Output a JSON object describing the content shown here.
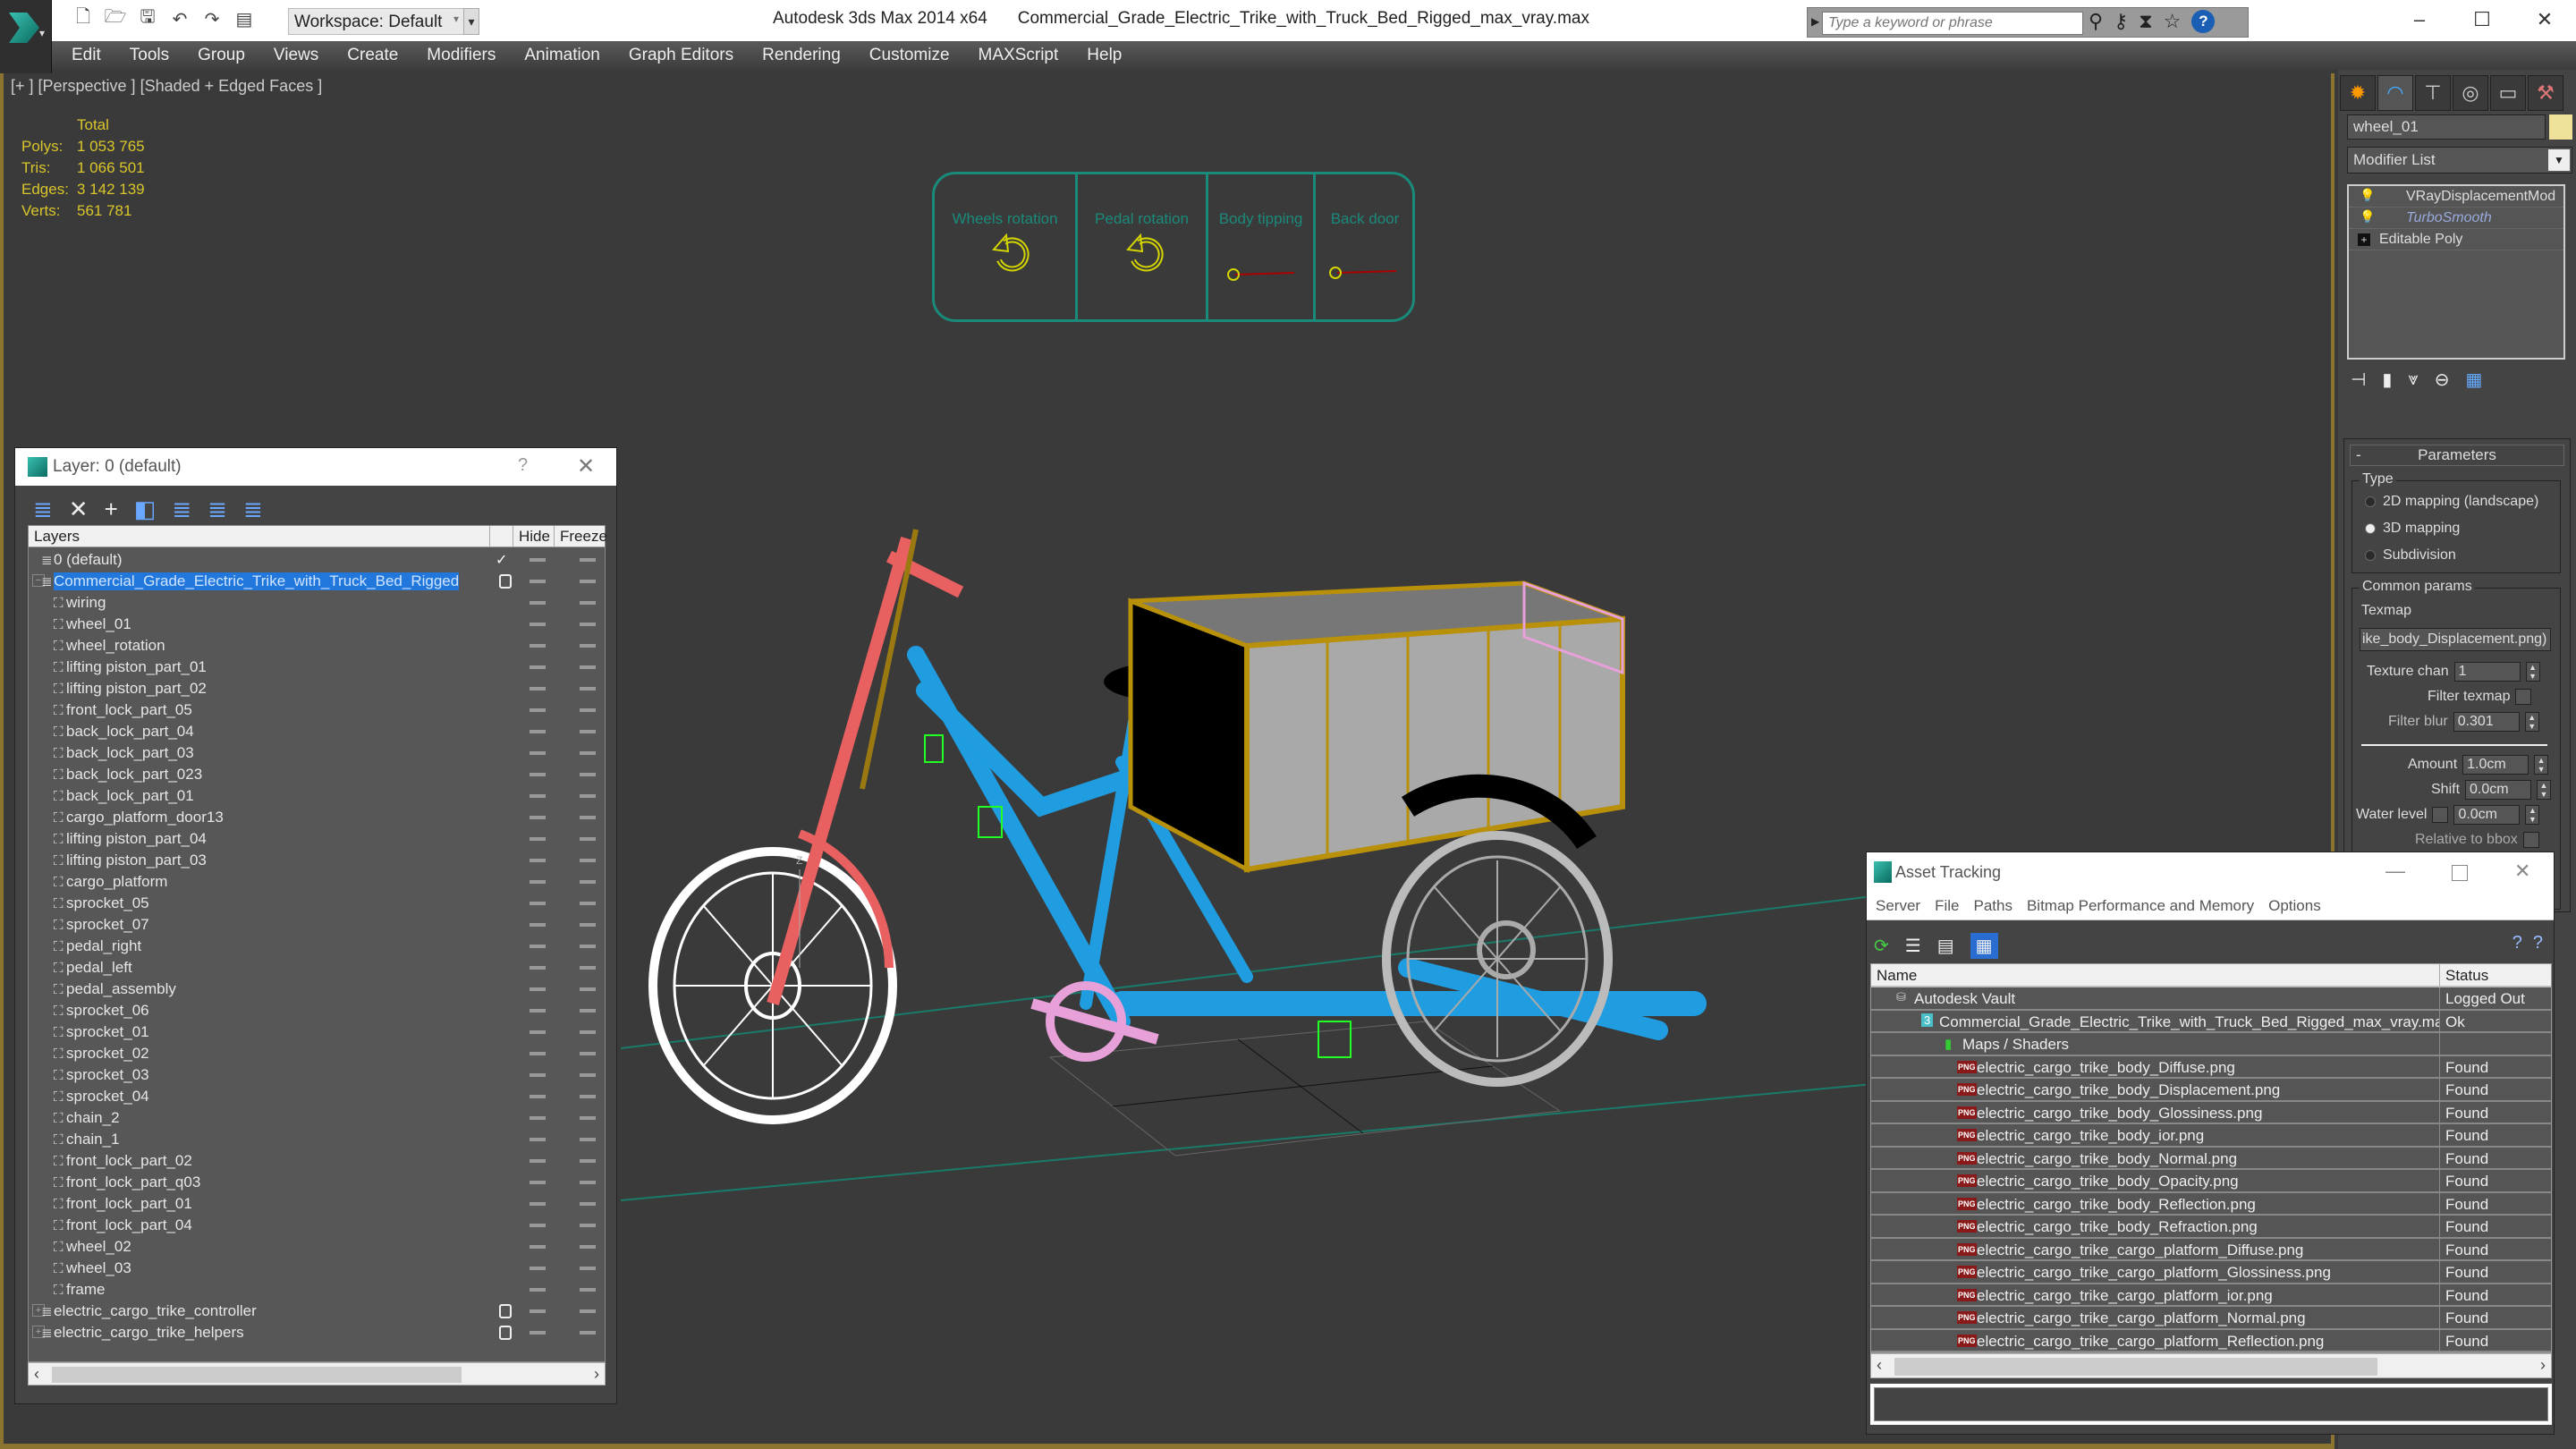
{
  "app": {
    "title": "Autodesk 3ds Max 2014 x64",
    "file": "Commercial_Grade_Electric_Trike_with_Truck_Bed_Rigged_max_vray.max",
    "workspace": "Workspace: Default",
    "search_placeholder": "Type a keyword or phrase",
    "help_glyph": "?",
    "window_controls": {
      "minimize": "–",
      "maximize": "☐",
      "close": "✕"
    }
  },
  "quick_access_icons": [
    "new-file-icon",
    "open-file-icon",
    "save-icon",
    "undo-icon",
    "redo-icon",
    "project-folder-icon"
  ],
  "menu": [
    "Edit",
    "Tools",
    "Group",
    "Views",
    "Create",
    "Modifiers",
    "Animation",
    "Graph Editors",
    "Rendering",
    "Customize",
    "MAXScript",
    "Help"
  ],
  "viewport": {
    "label": "[+ ] [Perspective ] [Shaded + Edged Faces ]",
    "stats": {
      "header": "Total",
      "rows": [
        {
          "k": "Polys:",
          "v": "1 053 765"
        },
        {
          "k": "Tris:",
          "v": "1 066 501"
        },
        {
          "k": "Edges:",
          "v": "3 142 139"
        },
        {
          "k": "Verts:",
          "v": "561 781"
        }
      ]
    },
    "rig_controls": [
      {
        "label": "Wheels rotation",
        "type": "rotate"
      },
      {
        "label": "Pedal rotation",
        "type": "rotate"
      },
      {
        "label": "Body tipping",
        "type": "slider"
      },
      {
        "label": "Back door",
        "type": "slider"
      }
    ],
    "axis_label": "Z"
  },
  "layer_dialog": {
    "title": "Layer: 0 (default)",
    "help": "?",
    "close": "✕",
    "columns": [
      "Layers",
      "",
      "Hide",
      "Freeze"
    ],
    "layers": [
      {
        "name": "0 (default)",
        "kind": "layer",
        "level": 0,
        "active": true
      },
      {
        "name": "Commercial_Grade_Electric_Trike_with_Truck_Bed_Rigged",
        "kind": "layer",
        "level": 0,
        "expanded": true,
        "selected": true
      },
      {
        "name": "wiring",
        "kind": "object",
        "level": 1
      },
      {
        "name": "wheel_01",
        "kind": "object",
        "level": 1
      },
      {
        "name": "wheel_rotation",
        "kind": "object",
        "level": 1
      },
      {
        "name": "lifting piston_part_01",
        "kind": "object",
        "level": 1
      },
      {
        "name": "lifting piston_part_02",
        "kind": "object",
        "level": 1
      },
      {
        "name": "front_lock_part_05",
        "kind": "object",
        "level": 1
      },
      {
        "name": "back_lock_part_04",
        "kind": "object",
        "level": 1
      },
      {
        "name": "back_lock_part_03",
        "kind": "object",
        "level": 1
      },
      {
        "name": "back_lock_part_023",
        "kind": "object",
        "level": 1
      },
      {
        "name": "back_lock_part_01",
        "kind": "object",
        "level": 1
      },
      {
        "name": "cargo_platform_door13",
        "kind": "object",
        "level": 1
      },
      {
        "name": "lifting piston_part_04",
        "kind": "object",
        "level": 1
      },
      {
        "name": "lifting piston_part_03",
        "kind": "object",
        "level": 1
      },
      {
        "name": "cargo_platform",
        "kind": "object",
        "level": 1
      },
      {
        "name": "sprocket_05",
        "kind": "object",
        "level": 1
      },
      {
        "name": "sprocket_07",
        "kind": "object",
        "level": 1
      },
      {
        "name": "pedal_right",
        "kind": "object",
        "level": 1
      },
      {
        "name": "pedal_left",
        "kind": "object",
        "level": 1
      },
      {
        "name": "pedal_assembly",
        "kind": "object",
        "level": 1
      },
      {
        "name": "sprocket_06",
        "kind": "object",
        "level": 1
      },
      {
        "name": "sprocket_01",
        "kind": "object",
        "level": 1
      },
      {
        "name": "sprocket_02",
        "kind": "object",
        "level": 1
      },
      {
        "name": "sprocket_03",
        "kind": "object",
        "level": 1
      },
      {
        "name": "sprocket_04",
        "kind": "object",
        "level": 1
      },
      {
        "name": "chain_2",
        "kind": "object",
        "level": 1
      },
      {
        "name": "chain_1",
        "kind": "object",
        "level": 1
      },
      {
        "name": "front_lock_part_02",
        "kind": "object",
        "level": 1
      },
      {
        "name": "front_lock_part_q03",
        "kind": "object",
        "level": 1
      },
      {
        "name": "front_lock_part_01",
        "kind": "object",
        "level": 1
      },
      {
        "name": "front_lock_part_04",
        "kind": "object",
        "level": 1
      },
      {
        "name": "wheel_02",
        "kind": "object",
        "level": 1
      },
      {
        "name": "wheel_03",
        "kind": "object",
        "level": 1
      },
      {
        "name": "frame",
        "kind": "object",
        "level": 1
      },
      {
        "name": "electric_cargo_trike_controller",
        "kind": "layer",
        "level": 0,
        "collapsed": true
      },
      {
        "name": "electric_cargo_trike_helpers",
        "kind": "layer",
        "level": 0,
        "collapsed": true
      }
    ]
  },
  "command_panel": {
    "tabs": [
      "create-icon",
      "modify-icon",
      "hierarchy-icon",
      "motion-icon",
      "display-icon",
      "utilities-icon"
    ],
    "object_name": "wheel_01",
    "object_color": "#efe09a",
    "modifier_list_label": "Modifier List",
    "stack": [
      {
        "name": "VRayDisplacementMod",
        "style": "normal",
        "icon": "bulb"
      },
      {
        "name": "TurboSmooth",
        "style": "italic",
        "icon": "bulb"
      },
      {
        "name": "Editable Poly",
        "style": "base",
        "icon": "plus"
      }
    ],
    "parameters": {
      "rollout": "Parameters",
      "type_label": "Type",
      "types": [
        {
          "label": "2D mapping (landscape)",
          "checked": false
        },
        {
          "label": "3D mapping",
          "checked": true
        },
        {
          "label": "Subdivision",
          "checked": false
        }
      ],
      "common_label": "Common params",
      "texmap_label": "Texmap",
      "texmap_value": "ike_body_Displacement.png)",
      "texture_chan_label": "Texture chan",
      "texture_chan": "1",
      "filter_texmap_label": "Filter texmap",
      "filter_blur_label": "Filter blur",
      "filter_blur": "0.301",
      "amount_label": "Amount",
      "amount": "1.0cm",
      "shift_label": "Shift",
      "shift": "0.0cm",
      "water_level_label": "Water level",
      "water_level": "0.0cm",
      "relative_label": "Relative to bbox"
    }
  },
  "asset_tracking": {
    "title": "Asset Tracking",
    "menu": [
      "Server",
      "File",
      "Paths",
      "Bitmap Performance and Memory",
      "Options"
    ],
    "columns": [
      "Name",
      "Status"
    ],
    "rows": [
      {
        "name": "Autodesk Vault",
        "status": "Logged Out",
        "icon": "vault",
        "level": 0
      },
      {
        "name": "Commercial_Grade_Electric_Trike_with_Truck_Bed_Rigged_max_vray.max",
        "status": "Ok",
        "icon": "max",
        "level": 1
      },
      {
        "name": "Maps / Shaders",
        "status": "",
        "icon": "map",
        "level": 2
      },
      {
        "name": "electric_cargo_trike_body_Diffuse.png",
        "status": "Found",
        "icon": "png",
        "level": 3
      },
      {
        "name": "electric_cargo_trike_body_Displacement.png",
        "status": "Found",
        "icon": "png",
        "level": 3
      },
      {
        "name": "electric_cargo_trike_body_Glossiness.png",
        "status": "Found",
        "icon": "png",
        "level": 3
      },
      {
        "name": "electric_cargo_trike_body_ior.png",
        "status": "Found",
        "icon": "png",
        "level": 3
      },
      {
        "name": "electric_cargo_trike_body_Normal.png",
        "status": "Found",
        "icon": "png",
        "level": 3
      },
      {
        "name": "electric_cargo_trike_body_Opacity.png",
        "status": "Found",
        "icon": "png",
        "level": 3
      },
      {
        "name": "electric_cargo_trike_body_Reflection.png",
        "status": "Found",
        "icon": "png",
        "level": 3
      },
      {
        "name": "electric_cargo_trike_body_Refraction.png",
        "status": "Found",
        "icon": "png",
        "level": 3
      },
      {
        "name": "electric_cargo_trike_cargo_platform_Diffuse.png",
        "status": "Found",
        "icon": "png",
        "level": 3
      },
      {
        "name": "electric_cargo_trike_cargo_platform_Glossiness.png",
        "status": "Found",
        "icon": "png",
        "level": 3
      },
      {
        "name": "electric_cargo_trike_cargo_platform_ior.png",
        "status": "Found",
        "icon": "png",
        "level": 3
      },
      {
        "name": "electric_cargo_trike_cargo_platform_Normal.png",
        "status": "Found",
        "icon": "png",
        "level": 3
      },
      {
        "name": "electric_cargo_trike_cargo_platform_Reflection.png",
        "status": "Found",
        "icon": "png",
        "level": 3
      }
    ]
  },
  "colors": {
    "accent_gold": "#8a7430",
    "stats_yellow": "#d9c52b",
    "rig_teal": "#1a8a7a",
    "selection_blue": "#2277dd",
    "frame_blue": "#1f9de0",
    "fork_red": "#e86060",
    "cargo_gold": "#b8900a"
  }
}
